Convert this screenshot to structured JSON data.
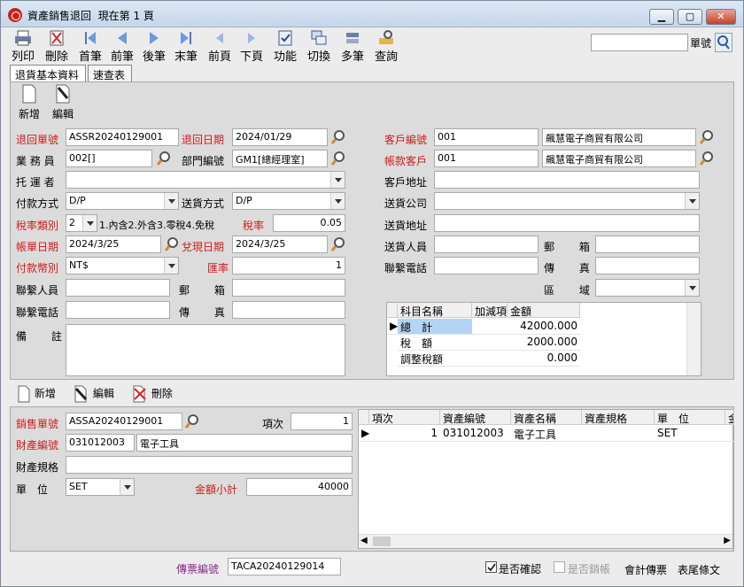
{
  "window": {
    "title": "資產銷售退回",
    "page_label": "現在第 1 頁"
  },
  "toolbar": [
    "列印",
    "刪除",
    "首筆",
    "前筆",
    "後筆",
    "末筆",
    "前頁",
    "下頁",
    "功能",
    "切換",
    "多筆",
    "查詢"
  ],
  "search": {
    "value": "",
    "label": "單號"
  },
  "tabs": [
    "退貨基本資料",
    "速查表"
  ],
  "upper_actions": [
    "新增",
    "編輯"
  ],
  "form": {
    "return_no_label": "退回單號",
    "return_no": "ASSR20240129001",
    "return_date_label": "退回日期",
    "return_date": "2024/01/29",
    "customer_no_label": "客戶編號",
    "customer_no": "001",
    "customer_name": "飆慧電子商貿有限公司",
    "salesperson_label": "業 務 員",
    "salesperson": "002[]",
    "dept_label": "部門編號",
    "dept": "GM1[總經理室]",
    "account_customer_label": "帳款客戶",
    "account_customer_no": "001",
    "account_customer_name": "飆慧電子商貿有限公司",
    "carrier_label": "托 運 者",
    "carrier": "",
    "customer_address_label": "客戶地址",
    "customer_address": "",
    "pay_method_label": "付款方式",
    "pay_method": "D/P",
    "ship_method_label": "送貨方式",
    "ship_method": "D/P",
    "ship_company_label": "送貨公司",
    "ship_company": "",
    "tax_type_label": "稅率類別",
    "tax_type": "2",
    "tax_type_desc": "1.內含2.外含3.零稅4.免稅",
    "tax_rate_label": "稅率",
    "tax_rate": "0.05",
    "ship_address_label": "送貨地址",
    "ship_address": "",
    "bill_date_label": "帳單日期",
    "bill_date": "2024/3/25",
    "cash_date_label": "兌現日期",
    "cash_date": "2024/3/25",
    "ship_person_label": "送貨人員",
    "ship_person": "",
    "postal_label": "郵 箱",
    "postal": "",
    "currency_label": "付款幣別",
    "currency": "NT$",
    "exchange_label": "匯率",
    "exchange": "1",
    "contact_phone_label": "聯繫電話",
    "contact_phone": "",
    "fax_label": "傳 真",
    "fax": "",
    "contact_person_label": "聯繫人員",
    "contact_person": "",
    "postal2_label": "郵 箱",
    "postal2": "",
    "region_label": "區 域",
    "region": "",
    "contact_phone2_label": "聯繫電話",
    "contact_phone2": "",
    "fax2_label": "傳 真",
    "fax2": "",
    "remark_label": "備 註",
    "remark": ""
  },
  "totals": {
    "headers": [
      "科目名稱",
      "加減項",
      "金額"
    ],
    "rows": [
      {
        "name": "總　計",
        "sign": "",
        "amount": "42000.000"
      },
      {
        "name": "稅　額",
        "sign": "",
        "amount": "2000.000"
      },
      {
        "name": "調整稅額",
        "sign": "",
        "amount": "0.000"
      }
    ]
  },
  "lower_actions": [
    "新增",
    "編輯",
    "刪除"
  ],
  "detail": {
    "sales_no_label": "銷售單號",
    "sales_no": "ASSA20240129001",
    "item_no_label": "項次",
    "item_no": "1",
    "asset_no_label": "財產編號",
    "asset_no": "031012003",
    "asset_name": "電子工具",
    "spec_label": "財產規格",
    "spec": "",
    "unit_label": "單　位",
    "unit": "SET",
    "subtotal_label": "金額小計",
    "subtotal": "40000"
  },
  "detail_grid": {
    "headers": [
      "項次",
      "資產編號",
      "資產名稱",
      "資產規格",
      "單　位",
      "金"
    ],
    "rows": [
      {
        "item": "1",
        "asset_no": "031012003",
        "asset_name": "電子工具",
        "spec": "",
        "unit": "SET",
        "amt": ""
      }
    ]
  },
  "footer": {
    "voucher_label": "傳票編號",
    "voucher": "TACA20240129014",
    "confirmed_label": "是否確認",
    "posted_label": "是否銷帳",
    "accounting_label": "會計傳票",
    "footnote_label": "表尾條文"
  }
}
